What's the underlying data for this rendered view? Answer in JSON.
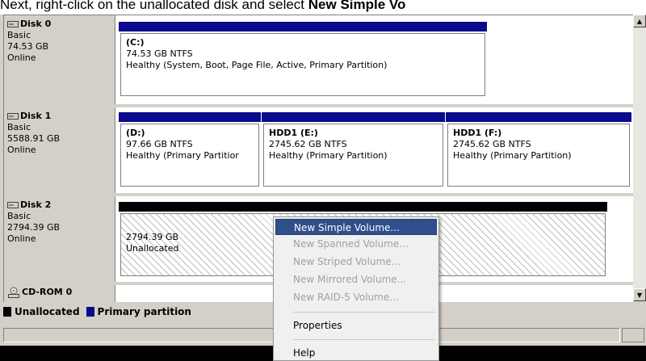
{
  "caption": {
    "prefix": "Next, right-click on the unallocated disk and select ",
    "bold": "New Simple Vo"
  },
  "disks": [
    {
      "name": "Disk 0",
      "type": "Basic",
      "size": "74.53 GB",
      "status": "Online",
      "partitions": [
        {
          "name": "(C:)",
          "fs": "74.53 GB NTFS",
          "health": "Healthy (System, Boot, Page File, Active, Primary Partition)"
        }
      ]
    },
    {
      "name": "Disk 1",
      "type": "Basic",
      "size": "5588.91 GB",
      "status": "Online",
      "partitions": [
        {
          "name": "(D:)",
          "fs": "97.66 GB NTFS",
          "health": "Healthy (Primary Partitior"
        },
        {
          "name": "HDD1  (E:)",
          "fs": "2745.62 GB NTFS",
          "health": "Healthy (Primary Partition)"
        },
        {
          "name": "HDD1  (F:)",
          "fs": "2745.62 GB NTFS",
          "health": "Healthy (Primary Partition)"
        }
      ]
    },
    {
      "name": "Disk 2",
      "type": "Basic",
      "size": "2794.39 GB",
      "status": "Online",
      "partitions": [
        {
          "size": "2794.39 GB",
          "label": "Unallocated"
        }
      ]
    },
    {
      "name": "CD-ROM 0"
    }
  ],
  "legend": {
    "unallocated": "Unallocated",
    "primary": "Primary partition",
    "unallocated_color": "#000000",
    "primary_color": "#0a0a8c"
  },
  "context_menu": {
    "items": [
      {
        "label": "New Simple Volume...",
        "state": "highlighted"
      },
      {
        "label": "New Spanned Volume...",
        "state": "disabled"
      },
      {
        "label": "New Striped Volume...",
        "state": "disabled"
      },
      {
        "label": "New Mirrored Volume...",
        "state": "disabled"
      },
      {
        "label": "New RAID-5 Volume...",
        "state": "disabled"
      },
      {
        "label": "Properties",
        "state": "enabled"
      },
      {
        "label": "Help",
        "state": "enabled"
      }
    ]
  },
  "icons": {
    "disk": "hard-disk-icon",
    "cdrom": "cdrom-icon",
    "scroll_up": "scroll-up-arrow-icon",
    "scroll_down": "scroll-down-arrow-icon"
  }
}
